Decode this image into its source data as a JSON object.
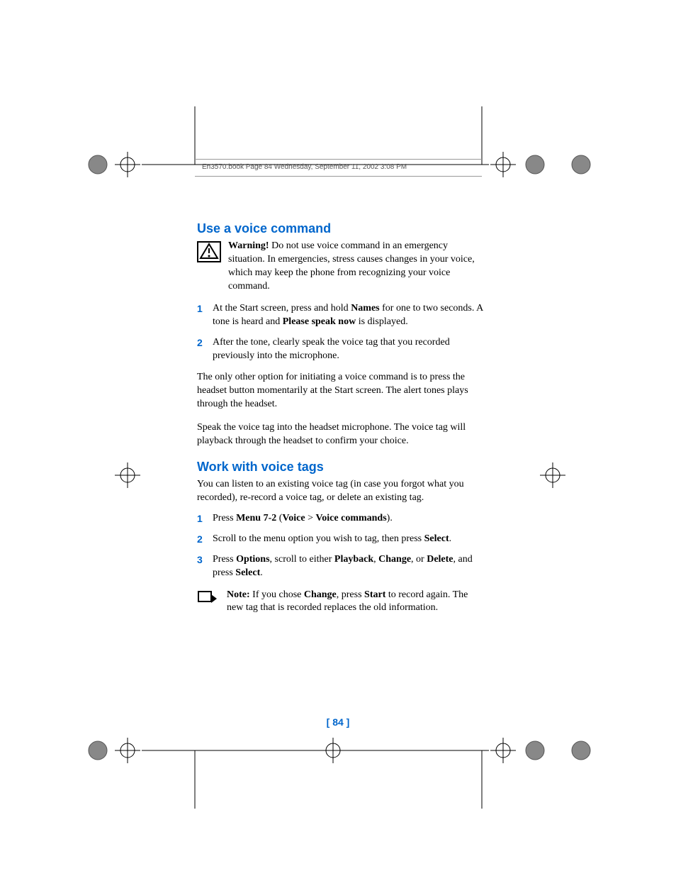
{
  "header": {
    "text": "En3570.book  Page 84  Wednesday, September 11, 2002  3:08 PM"
  },
  "section1": {
    "heading": "Use a voice command",
    "warning_label": "Warning!",
    "warning_text": " Do not use voice command in an emergency situation. In emergencies, stress causes changes in your voice, which may keep the phone from recognizing your voice command.",
    "step1_num": "1",
    "step1_a": "At the Start screen, press and hold ",
    "step1_b": "Names",
    "step1_c": " for one to two seconds. A tone is heard and ",
    "step1_d": "Please speak now",
    "step1_e": " is displayed.",
    "step2_num": "2",
    "step2": "After the tone, clearly speak the voice tag that you recorded previously into the microphone.",
    "para1": "The only other option for initiating a voice command is to press the headset button momentarily at the Start screen. The alert tones plays through the headset.",
    "para2": "Speak the voice tag into the headset microphone. The voice tag will playback through the headset to confirm your choice."
  },
  "section2": {
    "heading": "Work with voice tags",
    "intro": "You can listen to an existing voice tag (in case you forgot what you recorded), re-record a voice tag, or delete an existing tag.",
    "step1_num": "1",
    "step1_a": "Press ",
    "step1_b": "Menu 7-2",
    "step1_c": " (",
    "step1_d": "Voice",
    "step1_e": " > ",
    "step1_f": "Voice commands",
    "step1_g": ").",
    "step2_num": "2",
    "step2_a": "Scroll to the menu option you wish to tag, then press ",
    "step2_b": "Select",
    "step2_c": ".",
    "step3_num": "3",
    "step3_a": "Press ",
    "step3_b": "Options",
    "step3_c": ", scroll to either ",
    "step3_d": "Playback",
    "step3_e": ", ",
    "step3_f": "Change",
    "step3_g": ", or ",
    "step3_h": "Delete",
    "step3_i": ", and press ",
    "step3_j": "Select",
    "step3_k": ".",
    "note_label": "Note:",
    "note_a": " If you chose ",
    "note_b": "Change",
    "note_c": ", press ",
    "note_d": "Start",
    "note_e": " to record again. The new tag that is recorded replaces the old information."
  },
  "footer": {
    "page_number": "[ 84 ]"
  }
}
